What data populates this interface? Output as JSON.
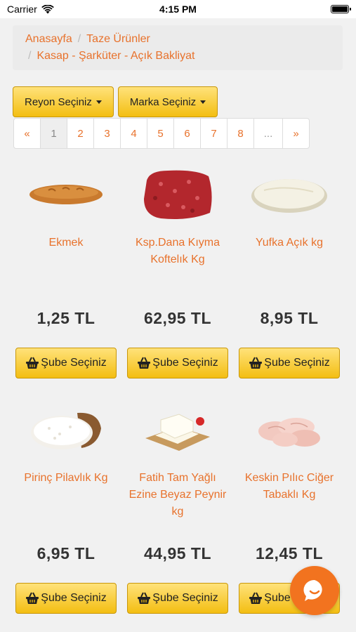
{
  "status_bar": {
    "carrier": "Carrier",
    "time": "4:15 PM",
    "battery_level": 1.0
  },
  "breadcrumb": {
    "items": [
      "Anasayfa",
      "Taze Ürünler",
      "Kasap - Şarküter - Açık Bakliyat"
    ]
  },
  "filters": {
    "reyon_label": "Reyon Seçiniz",
    "marka_label": "Marka Seçiniz"
  },
  "pagination": {
    "prev": "«",
    "pages": [
      "1",
      "2",
      "3",
      "4",
      "5",
      "6",
      "7",
      "8"
    ],
    "ellipsis": "...",
    "next": "»",
    "current": "1"
  },
  "products": [
    {
      "name": "Ekmek",
      "price": "1,25 TL",
      "button": "Şube Seçiniz",
      "icon": "bread-image"
    },
    {
      "name": "Ksp.Dana Kıyma Koftelık Kg",
      "price": "62,95 TL",
      "button": "Şube Seçiniz",
      "icon": "minced-meat-image"
    },
    {
      "name": "Yufka Açık kg",
      "price": "8,95 TL",
      "button": "Şube Seçiniz",
      "icon": "yufka-image"
    },
    {
      "name": "Pirinç Pilavlık Kg",
      "price": "6,95 TL",
      "button": "Şube Seçiniz",
      "icon": "rice-image"
    },
    {
      "name": "Fatih Tam Yağlı Ezine Beyaz Peynir kg",
      "price": "44,95 TL",
      "button": "Şube Seçiniz",
      "icon": "cheese-image"
    },
    {
      "name": "Keskin Pılıc Ciğer Tabaklı Kg",
      "price": "12,45 TL",
      "button": "Şube Seçiniz",
      "icon": "chicken-image"
    }
  ],
  "colors": {
    "accent": "#e8722c",
    "button_yellow": "#f3be12",
    "chat_orange": "#f2731f"
  }
}
